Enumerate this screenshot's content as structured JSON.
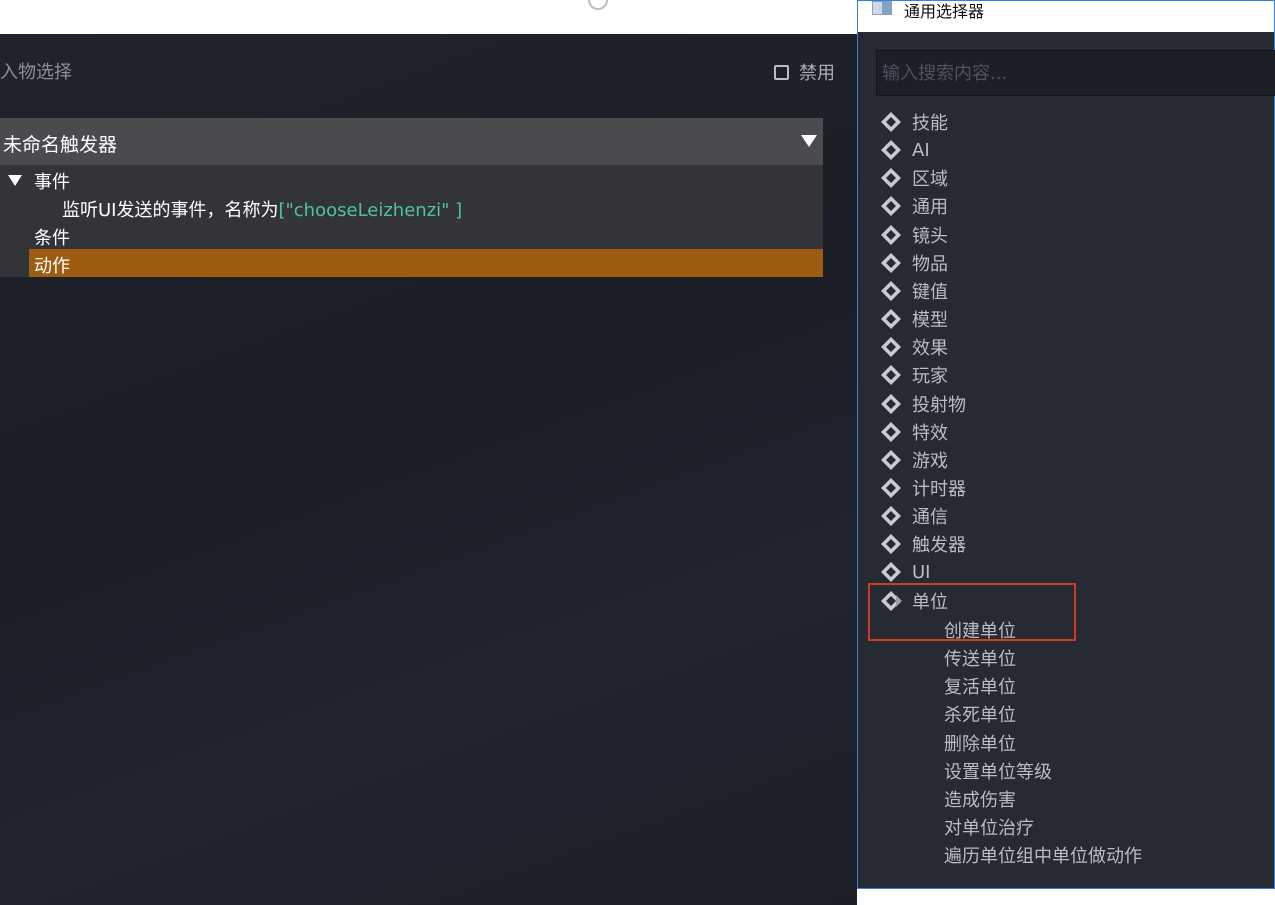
{
  "editor": {
    "page_title": "入物选择",
    "disable_label": "禁用",
    "trigger_name": "未命名触发器",
    "tree": {
      "event_label": "事件",
      "event_text": "监听UI发送的事件，名称为",
      "event_param": "[\"chooseLeizhenzi\" ]",
      "condition_label": "条件",
      "action_label": "动作"
    }
  },
  "picker": {
    "title": "通用选择器",
    "search_placeholder": "输入搜索内容...",
    "categories": [
      "技能",
      "AI",
      "区域",
      "通用",
      "镜头",
      "物品",
      "键值",
      "模型",
      "效果",
      "玩家",
      "投射物",
      "特效",
      "游戏",
      "计时器",
      "通信",
      "触发器",
      "UI",
      "单位"
    ],
    "unit_subitems": [
      "创建单位",
      "传送单位",
      "复活单位",
      "杀死单位",
      "删除单位",
      "设置单位等级",
      "造成伤害",
      "对单位治疗",
      "遍历单位组中单位做动作"
    ]
  },
  "colors": {
    "action_highlight": "#9c5c12",
    "param_text": "#4fc3a1",
    "annotation_box": "#d43a1e",
    "picker_border": "#3c7dd8"
  }
}
